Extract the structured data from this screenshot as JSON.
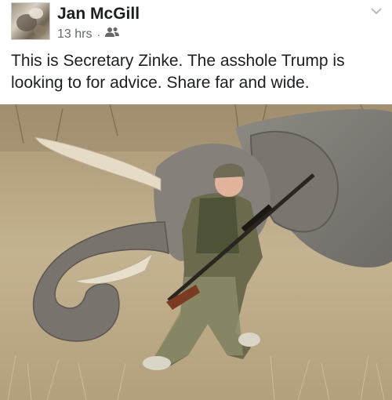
{
  "post": {
    "author": "Jan McGill",
    "timestamp": "13 hrs",
    "separator": "·",
    "audience_icon": "friends-icon",
    "menu_icon": "chevron-down-icon",
    "text": "This is Secretary Zinke. The asshole Trump is looking to for advice. Share far and wide."
  },
  "colors": {
    "author": "#1c1e21",
    "meta": "#65676b",
    "text": "#1c1e21"
  }
}
